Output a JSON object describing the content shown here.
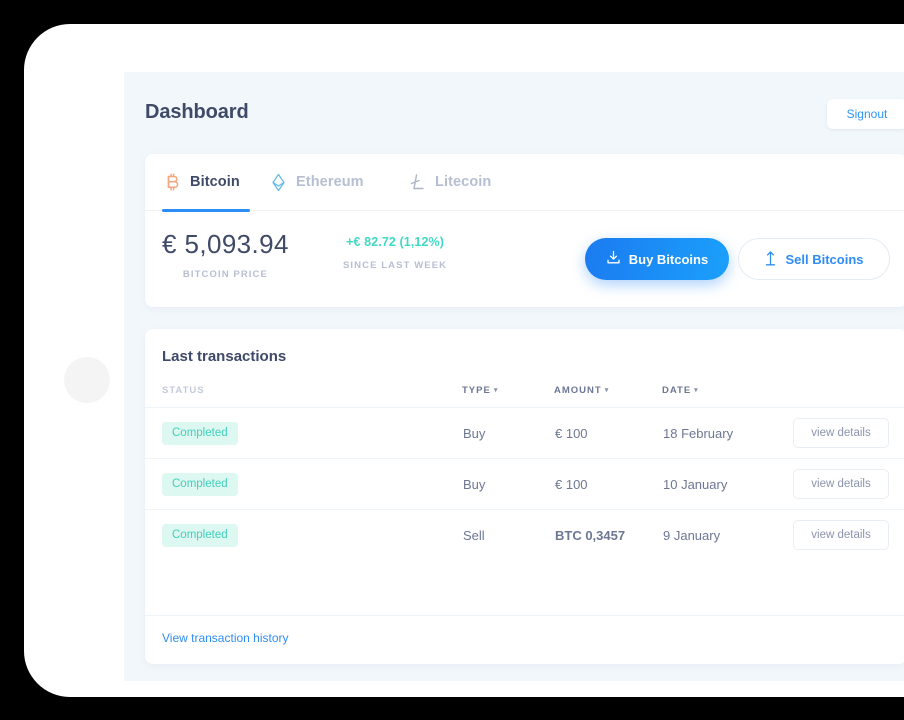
{
  "header": {
    "title": "Dashboard",
    "signout_label": "Signout"
  },
  "tabs": [
    {
      "label": "Bitcoin",
      "icon": "bitcoin-icon",
      "active": true
    },
    {
      "label": "Ethereum",
      "icon": "ethereum-icon",
      "active": false
    },
    {
      "label": "Litecoin",
      "icon": "litecoin-icon",
      "active": false
    }
  ],
  "price": {
    "value": "€ 5,093.94",
    "caption": "BITCOIN PRICE",
    "change": "+€ 82.72 (1,12%)",
    "change_caption": "SINCE LAST WEEK",
    "buy_label": "Buy Bitcoins",
    "sell_label": "Sell Bitcoins",
    "buy_icon": "download-icon",
    "sell_icon": "upload-arrow-icon"
  },
  "transactions": {
    "title": "Last transactions",
    "columns": {
      "status": "STATUS",
      "type": "TYPE",
      "amount": "AMOUNT",
      "date": "DATE"
    },
    "sort_caret": "▾",
    "rows": [
      {
        "status": "Completed",
        "type": "Buy",
        "amount": "€ 100",
        "amount_bold": false,
        "date": "18 February",
        "action": "view details"
      },
      {
        "status": "Completed",
        "type": "Buy",
        "amount": "€ 100",
        "amount_bold": false,
        "date": "10 January",
        "action": "view details"
      },
      {
        "status": "Completed",
        "type": "Sell",
        "amount": "BTC 0,3457",
        "amount_bold": true,
        "date": "9 January",
        "action": "view details"
      }
    ],
    "history_link": "View transaction history"
  },
  "colors": {
    "accent_blue": "#2b8df7",
    "title_navy": "#3f4a68",
    "teal": "#3fd9c4",
    "badge_bg": "#ddf7f1",
    "bitcoin_orange": "#f4a67d",
    "ethereum_blue": "#5fb8e8",
    "litecoin_gray": "#aeb6c6",
    "surface": "#f2f7fb"
  }
}
